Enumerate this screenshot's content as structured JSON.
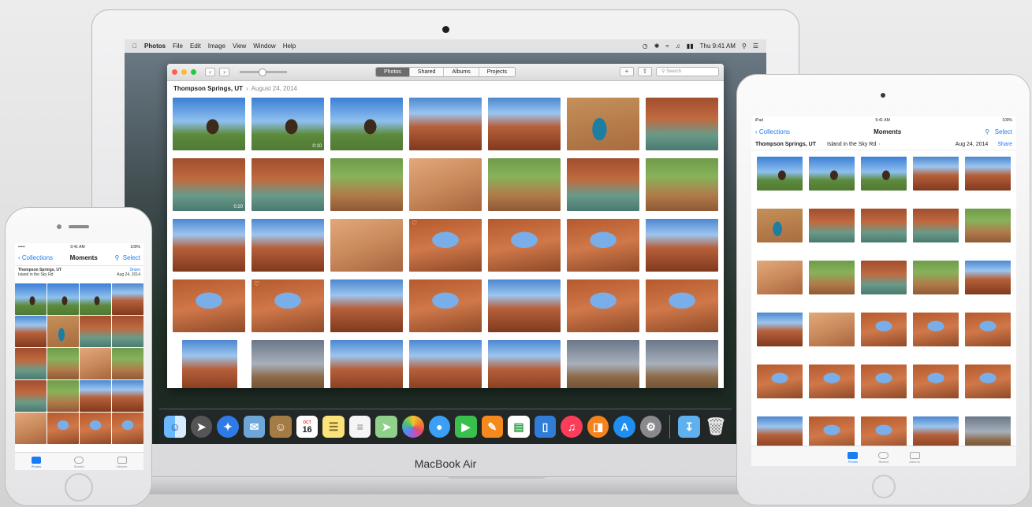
{
  "mac": {
    "brand": "MacBook Air",
    "menubar": {
      "apple_icon": "apple-icon",
      "app_name": "Photos",
      "menus": [
        "File",
        "Edit",
        "Image",
        "View",
        "Window",
        "Help"
      ],
      "clock": "Thu 9:41 AM"
    },
    "window": {
      "tabs": [
        "Photos",
        "Shared",
        "Albums",
        "Projects"
      ],
      "active_tab": "Photos",
      "search_placeholder": "Search",
      "add_label": "+",
      "location": "Thompson Springs, UT",
      "date": "August 24, 2014",
      "video_durations": [
        "0:10",
        "0:20"
      ]
    },
    "dock": {
      "icons": [
        "finder",
        "launchpad",
        "safari",
        "mail",
        "contacts",
        "calendar",
        "notes",
        "reminders",
        "maps",
        "photos",
        "messages",
        "facetime",
        "pages",
        "numbers",
        "keynote",
        "itunes",
        "ibooks",
        "app-store",
        "system-preferences",
        "downloads",
        "trash"
      ],
      "calendar": {
        "month": "OCT",
        "day": "16"
      }
    }
  },
  "iphone": {
    "status": {
      "carrier": "•••••",
      "time": "9:41 AM",
      "battery": "100%"
    },
    "nav": {
      "back": "Collections",
      "title": "Moments",
      "select": "Select"
    },
    "moment": {
      "location": "Thompson Springs, UT",
      "sublocation": "Island in the Sky Rd",
      "date": "Aug 24, 2014",
      "share": "Share"
    },
    "tabs": [
      "Photos",
      "Shared",
      "Albums"
    ],
    "active_tab": "Photos"
  },
  "ipad": {
    "status": {
      "device": "iPad",
      "time": "9:41 AM",
      "battery": "100%"
    },
    "nav": {
      "back": "Collections",
      "title": "Moments",
      "select": "Select"
    },
    "moment": {
      "location": "Thompson Springs, UT",
      "sublocation": "Island in the Sky Rd",
      "date": "Aug 24, 2014",
      "share": "Share"
    },
    "tabs": [
      "Photos",
      "Shared",
      "Albums"
    ],
    "active_tab": "Photos"
  }
}
